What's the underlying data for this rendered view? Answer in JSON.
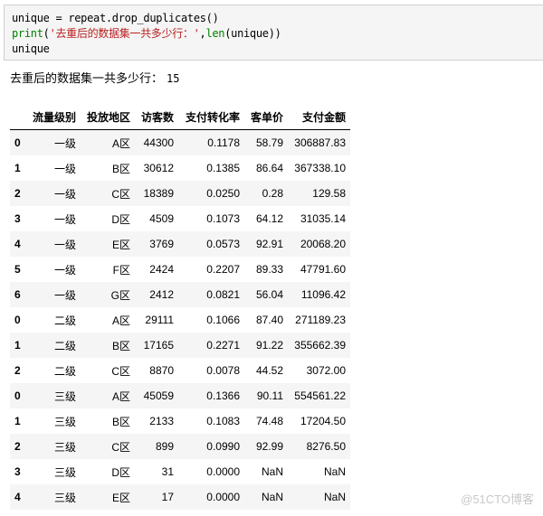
{
  "code_cell": {
    "lines": [
      {
        "parts": [
          {
            "text": "unique = repeat.drop_duplicates()",
            "cls": ""
          }
        ]
      },
      {
        "parts": [
          {
            "text": "print",
            "cls": "kw"
          },
          {
            "text": "(",
            "cls": ""
          },
          {
            "text": "'去重后的数据集一共多少行：'",
            "cls": "str"
          },
          {
            "text": ",",
            "cls": ""
          },
          {
            "text": "len",
            "cls": "kw"
          },
          {
            "text": "(unique))",
            "cls": ""
          }
        ]
      },
      {
        "parts": [
          {
            "text": "unique",
            "cls": ""
          }
        ]
      }
    ]
  },
  "output": {
    "label": "去重后的数据集一共多少行：",
    "value": "15"
  },
  "table": {
    "columns": [
      "",
      "流量级别",
      "投放地区",
      "访客数",
      "支付转化率",
      "客单价",
      "支付金额"
    ],
    "rows": [
      {
        "index": "0",
        "cells": [
          "一级",
          "A区",
          "44300",
          "0.1178",
          "58.79",
          "306887.83"
        ]
      },
      {
        "index": "1",
        "cells": [
          "一级",
          "B区",
          "30612",
          "0.1385",
          "86.64",
          "367338.10"
        ]
      },
      {
        "index": "2",
        "cells": [
          "一级",
          "C区",
          "18389",
          "0.0250",
          "0.28",
          "129.58"
        ]
      },
      {
        "index": "3",
        "cells": [
          "一级",
          "D区",
          "4509",
          "0.1073",
          "64.12",
          "31035.14"
        ]
      },
      {
        "index": "4",
        "cells": [
          "一级",
          "E区",
          "3769",
          "0.0573",
          "92.91",
          "20068.20"
        ]
      },
      {
        "index": "5",
        "cells": [
          "一级",
          "F区",
          "2424",
          "0.2207",
          "89.33",
          "47791.60"
        ]
      },
      {
        "index": "6",
        "cells": [
          "一级",
          "G区",
          "2412",
          "0.0821",
          "56.04",
          "11096.42"
        ]
      },
      {
        "index": "0",
        "cells": [
          "二级",
          "A区",
          "29111",
          "0.1066",
          "87.40",
          "271189.23"
        ]
      },
      {
        "index": "1",
        "cells": [
          "二级",
          "B区",
          "17165",
          "0.2271",
          "91.22",
          "355662.39"
        ]
      },
      {
        "index": "2",
        "cells": [
          "二级",
          "C区",
          "8870",
          "0.0078",
          "44.52",
          "3072.00"
        ]
      },
      {
        "index": "0",
        "cells": [
          "三级",
          "A区",
          "45059",
          "0.1366",
          "90.11",
          "554561.22"
        ]
      },
      {
        "index": "1",
        "cells": [
          "三级",
          "B区",
          "2133",
          "0.1083",
          "74.48",
          "17204.50"
        ]
      },
      {
        "index": "2",
        "cells": [
          "三级",
          "C区",
          "899",
          "0.0990",
          "92.99",
          "8276.50"
        ]
      },
      {
        "index": "3",
        "cells": [
          "三级",
          "D区",
          "31",
          "0.0000",
          "NaN",
          "NaN"
        ]
      },
      {
        "index": "4",
        "cells": [
          "三级",
          "E区",
          "17",
          "0.0000",
          "NaN",
          "NaN"
        ]
      }
    ]
  },
  "watermark": "@51CTO博客"
}
